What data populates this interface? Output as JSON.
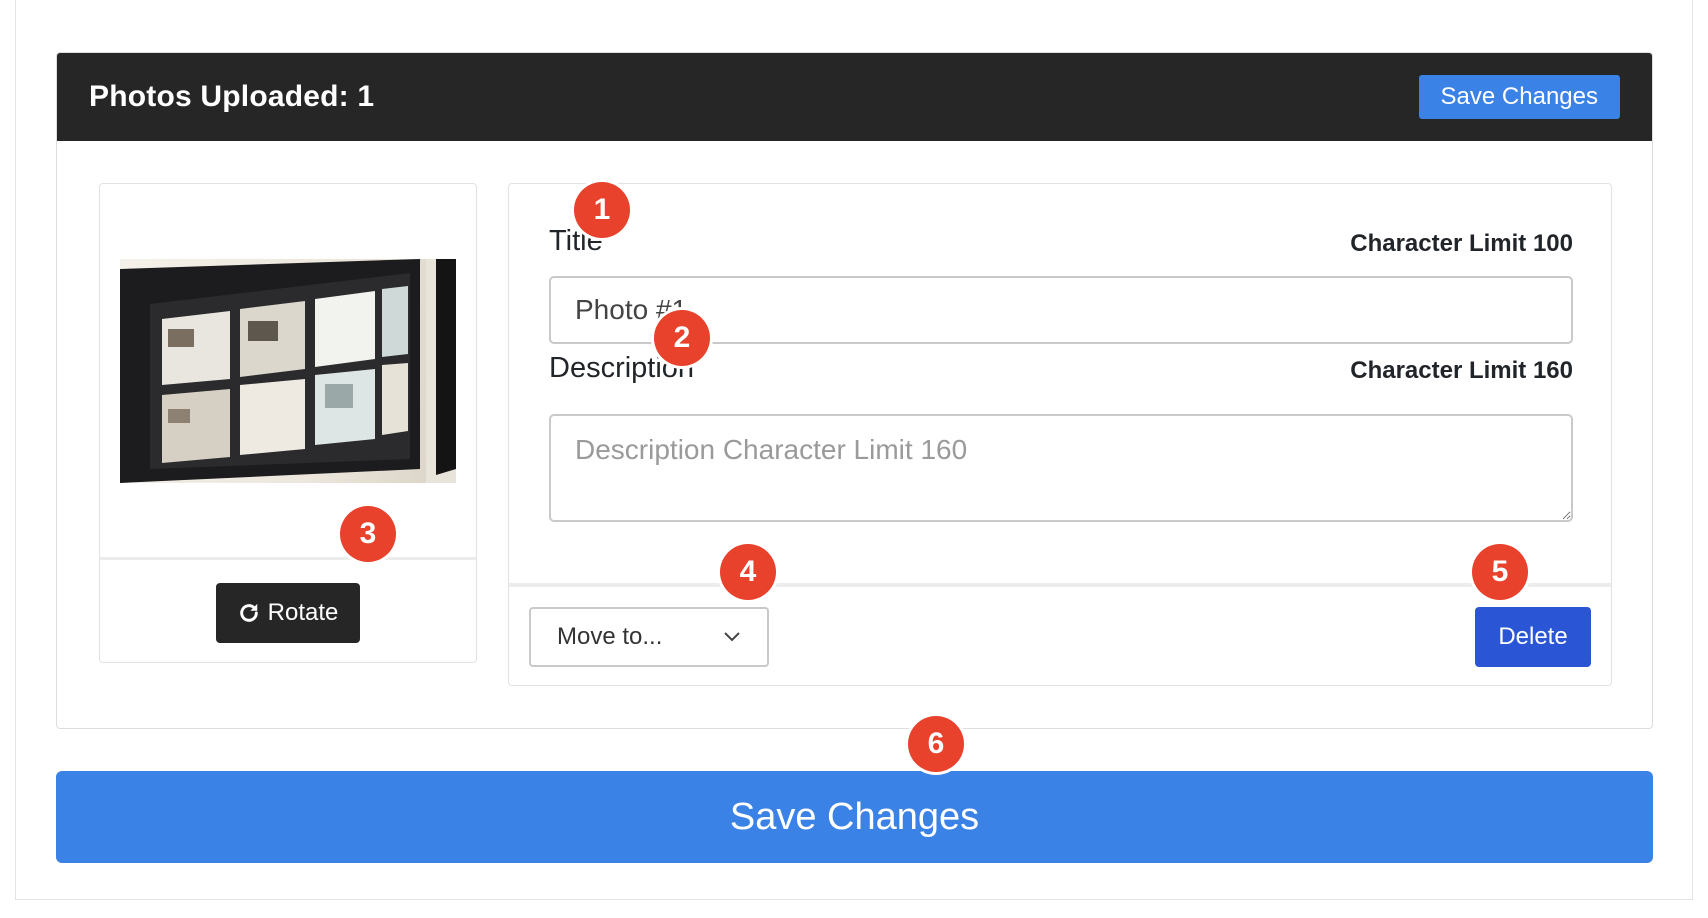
{
  "header": {
    "title": "Photos Uploaded: 1",
    "save_label": "Save Changes"
  },
  "photo_card": {
    "rotate_label": "Rotate",
    "rotate_icon": "rotate-cw-icon"
  },
  "form": {
    "title_label": "Title",
    "title_limit": "Character Limit 100",
    "title_value": "Photo #1",
    "description_label": "Description",
    "description_limit": "Character Limit 160",
    "description_placeholder": "Description Character Limit 160",
    "move_select": {
      "selected": "Move to...",
      "icon": "chevron-down-icon"
    },
    "delete_label": "Delete"
  },
  "footer": {
    "save_label": "Save Changes"
  },
  "markers": [
    "1",
    "2",
    "3",
    "4",
    "5",
    "6"
  ],
  "colors": {
    "header_bg": "#262626",
    "primary_blue": "#3b82e6",
    "delete_blue": "#2a56d6",
    "marker_red": "#e8412c"
  }
}
